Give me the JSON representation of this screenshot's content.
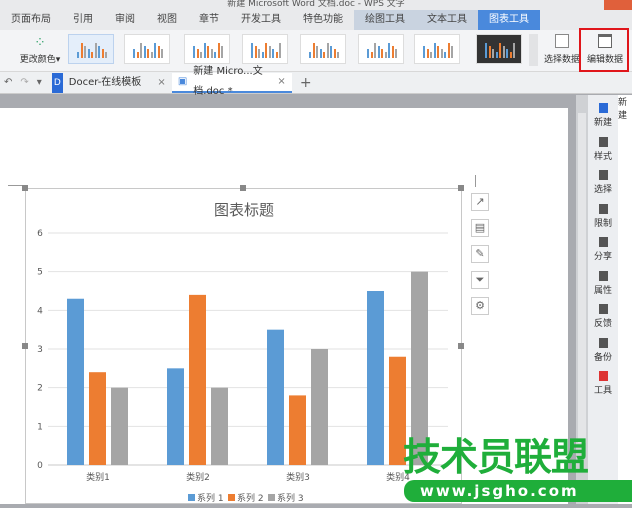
{
  "window": {
    "title": "新建 Microsoft Word 文档.doc - WPS 文字"
  },
  "menu": [
    "页面布局",
    "引用",
    "审阅",
    "视图",
    "章节",
    "开发工具",
    "特色功能",
    "绘图工具",
    "文本工具",
    "图表工具"
  ],
  "ribbon": {
    "change_color": "更改颜色",
    "select_data": "选择数据",
    "edit_data": "编辑数据"
  },
  "tabs": [
    {
      "label": "Docer-在线模板"
    },
    {
      "label": "新建 Micro...文档.doc *"
    }
  ],
  "side_panel": [
    "新建",
    "样式",
    "选择",
    "限制",
    "分享",
    "属性",
    "反馈",
    "备份",
    "工具"
  ],
  "colors": {
    "accent": "#4a89dc",
    "series1": "#5b9bd5",
    "series2": "#ed7d31",
    "series3": "#a5a5a5",
    "highlight": "#e0161b"
  },
  "chart_tools": [
    "chart-elements-icon",
    "chart-layout-icon",
    "chart-style-icon",
    "chart-filter-icon",
    "chart-settings-icon"
  ],
  "watermark": {
    "text": "技术员联盟",
    "url": "www.jsgho.com"
  },
  "chart_data": {
    "type": "bar",
    "title": "图表标题",
    "categories": [
      "类别1",
      "类别2",
      "类别3",
      "类别4"
    ],
    "series": [
      {
        "name": "系列 1",
        "values": [
          4.3,
          2.5,
          3.5,
          4.5
        ]
      },
      {
        "name": "系列 2",
        "values": [
          2.4,
          4.4,
          1.8,
          2.8
        ]
      },
      {
        "name": "系列 3",
        "values": [
          2,
          2,
          3,
          5
        ]
      }
    ],
    "ylim": [
      0,
      6
    ],
    "yticks": [
      0,
      1,
      2,
      3,
      4,
      5,
      6
    ],
    "grid": true,
    "legend": "bottom"
  }
}
